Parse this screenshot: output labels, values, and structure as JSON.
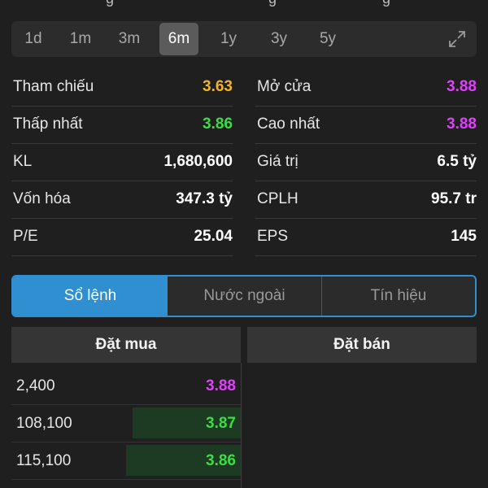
{
  "periods": {
    "items": [
      "1d",
      "1m",
      "3m",
      "6m",
      "1y",
      "3y",
      "5y"
    ],
    "active": "6m"
  },
  "icons": {
    "expand": "expand-arrows-icon"
  },
  "stats": [
    {
      "left_label": "Tham chiếu",
      "left_value": "3.63",
      "left_color": "yellow",
      "right_label": "Mở cửa",
      "right_value": "3.88",
      "right_color": "magenta"
    },
    {
      "left_label": "Thấp nhất",
      "left_value": "3.86",
      "left_color": "green",
      "right_label": "Cao nhất",
      "right_value": "3.88",
      "right_color": "magenta"
    },
    {
      "left_label": "KL",
      "left_value": "1,680,600",
      "left_color": "white",
      "right_label": "Giá trị",
      "right_value": "6.5 tỷ",
      "right_color": "white"
    },
    {
      "left_label": "Vốn hóa",
      "left_value": "347.3 tỷ",
      "left_color": "white",
      "right_label": "CPLH",
      "right_value": "95.7 tr",
      "right_color": "white"
    },
    {
      "left_label": "P/E",
      "left_value": "25.04",
      "left_color": "white",
      "right_label": "EPS",
      "right_value": "145",
      "right_color": "white"
    }
  ],
  "tabs": {
    "items": [
      "Sổ lệnh",
      "Nước ngoài",
      "Tín hiệu"
    ],
    "active": "Sổ lệnh"
  },
  "order_book": {
    "buy_header": "Đặt mua",
    "sell_header": "Đặt bán",
    "buy": [
      {
        "volume": "2,400",
        "price": "3.88",
        "color": "magenta",
        "depth": 0
      },
      {
        "volume": "108,100",
        "price": "3.87",
        "color": "green",
        "depth": 0.47
      },
      {
        "volume": "115,100",
        "price": "3.86",
        "color": "green",
        "depth": 0.5
      }
    ]
  },
  "colors": {
    "yellow": "#f0b429",
    "magenta": "#e040fb",
    "green": "#3ddc44",
    "accent_blue": "#2f8fd0",
    "background": "#1f1f1f"
  }
}
